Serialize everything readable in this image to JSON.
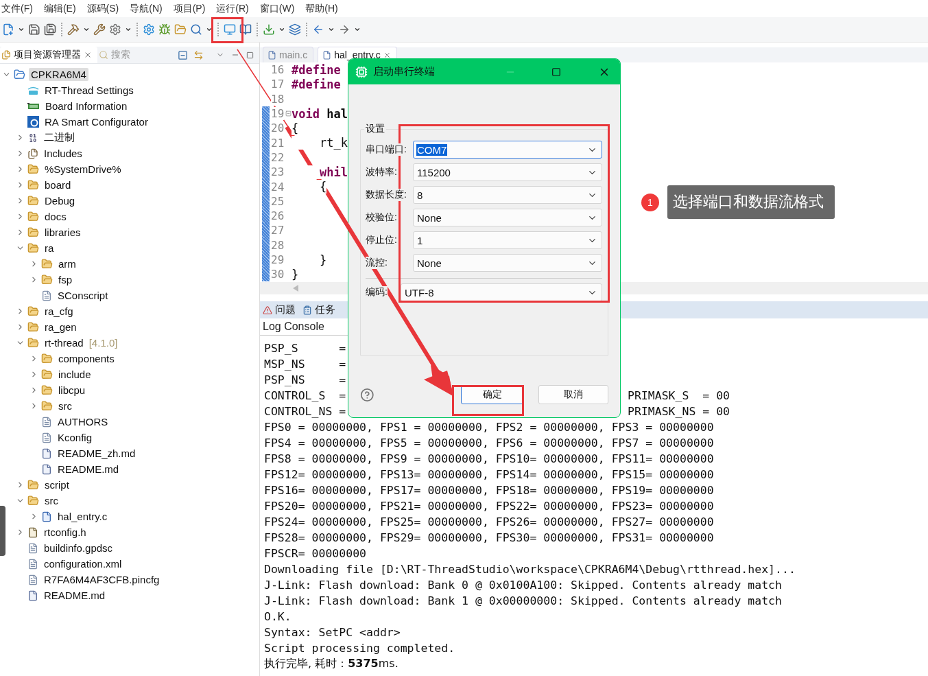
{
  "menu": [
    "文件(F)",
    "编辑(E)",
    "源码(S)",
    "导航(N)",
    "项目(P)",
    "运行(R)",
    "窗口(W)",
    "帮助(H)"
  ],
  "explorer": {
    "tabs": [
      {
        "label": "项目资源管理器",
        "selected": true
      },
      {
        "label": "搜索",
        "selected": false
      }
    ],
    "tree": [
      {
        "label": "CPKRA6M4",
        "kind": "project",
        "expanded": true,
        "selected": true,
        "children": [
          {
            "label": "RT-Thread Settings",
            "kind": "rt",
            "selected": false
          },
          {
            "label": "Board Information",
            "kind": "board",
            "selected": false
          },
          {
            "label": "RA Smart Configurator",
            "kind": "config",
            "selected": false
          },
          {
            "label": "二进制",
            "kind": "binary",
            "expanded": false,
            "selected": false
          },
          {
            "label": "Includes",
            "kind": "includes",
            "expanded": false,
            "selected": false
          },
          {
            "label": "%SystemDrive%",
            "kind": "folder",
            "expanded": false,
            "selected": false
          },
          {
            "label": "board",
            "kind": "folder",
            "expanded": false,
            "selected": false
          },
          {
            "label": "Debug",
            "kind": "folder",
            "expanded": false,
            "selected": false
          },
          {
            "label": "docs",
            "kind": "folder",
            "expanded": false,
            "selected": false
          },
          {
            "label": "libraries",
            "kind": "folder",
            "expanded": false,
            "selected": false
          },
          {
            "label": "ra",
            "kind": "folder",
            "expanded": true,
            "selected": false,
            "children": [
              {
                "label": "arm",
                "kind": "folder",
                "expanded": false,
                "selected": false
              },
              {
                "label": "fsp",
                "kind": "folder",
                "expanded": false,
                "selected": false
              },
              {
                "label": "SConscript",
                "kind": "file",
                "selected": false
              }
            ]
          },
          {
            "label": "ra_cfg",
            "kind": "folder",
            "expanded": false,
            "selected": false
          },
          {
            "label": "ra_gen",
            "kind": "folder",
            "expanded": false,
            "selected": false
          },
          {
            "label": "rt-thread",
            "note": "[4.1.0]",
            "kind": "folder",
            "expanded": true,
            "selected": false,
            "children": [
              {
                "label": "components",
                "kind": "folder",
                "expanded": false,
                "selected": false
              },
              {
                "label": "include",
                "kind": "folder",
                "expanded": false,
                "selected": false
              },
              {
                "label": "libcpu",
                "kind": "folder",
                "expanded": false,
                "selected": false
              },
              {
                "label": "src",
                "kind": "folder",
                "expanded": false,
                "selected": false
              },
              {
                "label": "AUTHORS",
                "kind": "file",
                "selected": false
              },
              {
                "label": "Kconfig",
                "kind": "file",
                "selected": false
              },
              {
                "label": "README_zh.md",
                "kind": "doc",
                "selected": false
              },
              {
                "label": "README.md",
                "kind": "doc",
                "selected": false
              }
            ]
          },
          {
            "label": "script",
            "kind": "folder",
            "expanded": false,
            "selected": false
          },
          {
            "label": "src",
            "kind": "folder",
            "expanded": true,
            "selected": false,
            "children": [
              {
                "label": "hal_entry.c",
                "kind": "cfile",
                "expanded": false,
                "selected": false
              }
            ]
          },
          {
            "label": "rtconfig.h",
            "kind": "hfile",
            "expanded": false,
            "selected": false
          },
          {
            "label": "buildinfo.gpdsc",
            "kind": "file",
            "selected": false
          },
          {
            "label": "configuration.xml",
            "kind": "file",
            "selected": false
          },
          {
            "label": "R7FA6M4AF3CFB.pincfg",
            "kind": "file",
            "selected": false
          },
          {
            "label": "README.md",
            "kind": "doc",
            "selected": false
          }
        ]
      }
    ]
  },
  "editor": {
    "tabs": [
      {
        "label": "main.c",
        "selected": false
      },
      {
        "label": "hal_entry.c",
        "selected": true
      }
    ],
    "lines": [
      {
        "number": "16",
        "changed": false,
        "code": [
          {
            "text": "#define",
            "kind": "keyword"
          }
        ]
      },
      {
        "number": "17",
        "changed": false,
        "code": [
          {
            "text": "#define",
            "kind": "keyword"
          }
        ]
      },
      {
        "number": "18",
        "changed": false
      },
      {
        "number": "19",
        "changed": true,
        "fold": true,
        "code": [
          {
            "text": "void",
            "kind": "keyword"
          },
          {
            "text": " hal",
            "kind": "name"
          }
        ]
      },
      {
        "number": "20",
        "changed": true,
        "code": [
          {
            "text": "{",
            "kind": "plain"
          }
        ]
      },
      {
        "number": "21",
        "changed": true,
        "code": [
          {
            "text": "    rt_k",
            "kind": "plain"
          }
        ]
      },
      {
        "number": "22",
        "changed": true
      },
      {
        "number": "23",
        "changed": true,
        "code": [
          {
            "text": "    whil",
            "kind": "keyword"
          }
        ]
      },
      {
        "number": "24",
        "changed": true,
        "code": [
          {
            "text": "    {",
            "kind": "plain"
          }
        ]
      },
      {
        "number": "25",
        "changed": true
      },
      {
        "number": "26",
        "changed": true
      },
      {
        "number": "27",
        "changed": true
      },
      {
        "number": "28",
        "changed": true
      },
      {
        "number": "29",
        "changed": true,
        "code": [
          {
            "text": "    }",
            "kind": "plain"
          }
        ]
      },
      {
        "number": "30",
        "changed": true,
        "code": [
          {
            "text": "}",
            "kind": "plain"
          }
        ]
      }
    ]
  },
  "bottom_panel": {
    "tabs": [
      "问题",
      "任务"
    ],
    "console_title": "Log Console",
    "lines": [
      {
        "kind": "mono",
        "text": "PSP_S      ="
      },
      {
        "kind": "mono",
        "text": "MSP_NS     ="
      },
      {
        "kind": "mono",
        "text": "PSP_NS     ="
      },
      {
        "kind": "mono",
        "text": "CONTROL_S  =",
        "right": "PRIMASK_S  = 00"
      },
      {
        "kind": "mono",
        "text": "CONTROL_NS =",
        "right": "PRIMASK_NS = 00"
      },
      {
        "kind": "mono",
        "text": "FPS0 = 00000000, FPS1 = 00000000, FPS2 = 00000000, FPS3 = 00000000"
      },
      {
        "kind": "mono",
        "text": "FPS4 = 00000000, FPS5 = 00000000, FPS6 = 00000000, FPS7 = 00000000"
      },
      {
        "kind": "mono",
        "text": "FPS8 = 00000000, FPS9 = 00000000, FPS10= 00000000, FPS11= 00000000"
      },
      {
        "kind": "mono",
        "text": "FPS12= 00000000, FPS13= 00000000, FPS14= 00000000, FPS15= 00000000"
      },
      {
        "kind": "mono",
        "text": "FPS16= 00000000, FPS17= 00000000, FPS18= 00000000, FPS19= 00000000"
      },
      {
        "kind": "mono",
        "text": "FPS20= 00000000, FPS21= 00000000, FPS22= 00000000, FPS23= 00000000"
      },
      {
        "kind": "mono",
        "text": "FPS24= 00000000, FPS25= 00000000, FPS26= 00000000, FPS27= 00000000"
      },
      {
        "kind": "mono",
        "text": "FPS28= 00000000, FPS29= 00000000, FPS30= 00000000, FPS31= 00000000"
      },
      {
        "kind": "mono",
        "text": "FPSCR= 00000000"
      },
      {
        "kind": "mono",
        "text": "Downloading file [D:\\RT-ThreadStudio\\workspace\\CPKRA6M4\\Debug\\rtthread.hex]..."
      },
      {
        "kind": "mono",
        "text": "J-Link: Flash download: Bank 0 @ 0x0100A100: Skipped. Contents already match"
      },
      {
        "kind": "mono",
        "text": "J-Link: Flash download: Bank 1 @ 0x00000000: Skipped. Contents already match"
      },
      {
        "kind": "mono",
        "text": "O.K."
      },
      {
        "kind": "mono",
        "text": "Syntax: SetPC <addr>"
      },
      {
        "kind": "mono",
        "text": "Script processing completed."
      },
      {
        "kind": "status",
        "text": "执行完毕, 耗时：**5375**ms."
      }
    ]
  },
  "dialog": {
    "title": "启动串行终端",
    "group": "设置",
    "fields": [
      {
        "label": "串口端口:",
        "value": "COM7",
        "focused": true
      },
      {
        "label": "波特率:",
        "value": "115200",
        "focused": false
      },
      {
        "label": "数据长度:",
        "value": "8",
        "focused": false
      },
      {
        "label": "校验位:",
        "value": "None",
        "focused": false
      },
      {
        "label": "停止位:",
        "value": "1",
        "focused": false
      },
      {
        "label": "流控:",
        "value": "None",
        "focused": false
      }
    ],
    "encoding": {
      "label": "编码:",
      "value": "UTF-8"
    },
    "buttons": [
      {
        "label": "确定",
        "default": true
      },
      {
        "label": "取消",
        "default": false
      }
    ]
  },
  "callout": {
    "badge": "1",
    "text": "选择端口和数据流格式"
  }
}
